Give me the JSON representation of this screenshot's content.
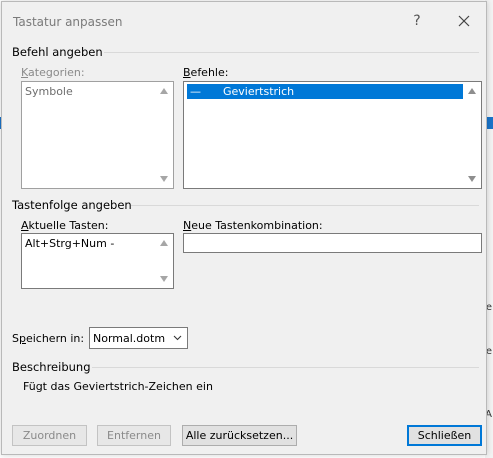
{
  "dialog": {
    "title": "Tastatur anpassen",
    "help_label": "?"
  },
  "command_group": {
    "label": "Befehl angeben",
    "categories_label_first": "K",
    "categories_label_rest": "ategorien:",
    "categories": [
      "Symbole"
    ],
    "commands_label_first": "B",
    "commands_label_rest": "efehle:",
    "commands": [
      {
        "symbol": "—",
        "name": "Geviertstrich",
        "selected": true
      }
    ]
  },
  "keys_group": {
    "label": "Tastenfolge angeben",
    "current_label_first": "A",
    "current_label_rest": "ktuelle Tasten:",
    "current_keys": [
      "Alt+Strg+Num -"
    ],
    "new_label_first": "N",
    "new_label_rest": "eue Tastenkombination:",
    "new_value": ""
  },
  "save": {
    "label_before": "S",
    "label_accel": "p",
    "label_after": "eichern in:",
    "value": "Normal.dotm"
  },
  "description": {
    "label": "Beschreibung",
    "text": "Fügt das Geviertstrich-Zeichen ein"
  },
  "buttons": {
    "assign": "Zuordnen",
    "remove": "Entfernen",
    "reset_all": "Alle zurücksetzen...",
    "close": "Schließen"
  },
  "background": {
    "glyph_1": "e",
    "glyph_2": "e",
    "glyph_3": "A"
  },
  "colors": {
    "accent": "#0078d7",
    "dialog_bg": "#f0f0f0"
  }
}
